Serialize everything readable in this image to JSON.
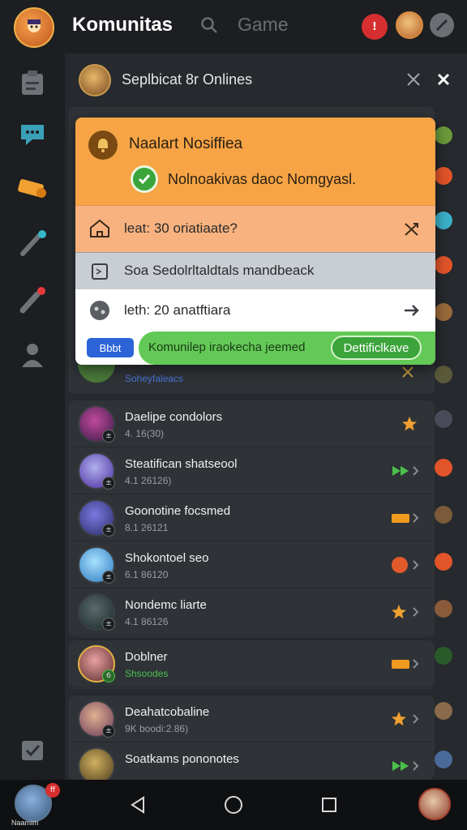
{
  "header": {
    "title": "Komunitas",
    "search_label": "Game",
    "notification_count": "!"
  },
  "panel": {
    "title": "Seplbicat 8r Onlines"
  },
  "popup": {
    "title": "Naalart Nosiffiea",
    "message": "Nolnoakivas daoc Nomgyasl.",
    "row1": "leat: 30 oriatiaate?",
    "row2": "Soa Sedolrltaldtals mandbeack",
    "row3": "leth: 20 anatftiara",
    "chip": "Bbbt",
    "banner": "Komunilep iraokecha jeemed",
    "cta": "Dettificlkave"
  },
  "partial_row": {
    "meta": "Soheyfaleacs"
  },
  "list1": [
    {
      "name": "Daelipe condolors",
      "meta": "4. 16(30)",
      "action": "star",
      "badge": "±"
    },
    {
      "name": "Steatifican shatseool",
      "meta": "4.1 26126)",
      "action": "arrow",
      "badge": "±"
    },
    {
      "name": "Goonotine focsmed",
      "meta": "8.1 26121",
      "action": "ticket",
      "badge": "±"
    },
    {
      "name": "Shokontoel seo",
      "meta": "6.1 86120",
      "action": "coin",
      "badge": "±"
    },
    {
      "name": "Nondemc liarte",
      "meta": "4.1 86126",
      "action": "star",
      "badge": "±"
    }
  ],
  "list2": [
    {
      "name": "Doblner",
      "meta": "Shsoodes",
      "action": "ticket",
      "badge": "6"
    }
  ],
  "list3": [
    {
      "name": "Deahatcobaline",
      "meta": "9K boodi:2.86)",
      "action": "star",
      "badge": "±"
    },
    {
      "name": "Soatkams pononotes",
      "meta": "",
      "action": "arrow",
      "badge": ""
    }
  ],
  "bottom_nav": {
    "avatar_label": "Naamim",
    "badge": "ff"
  },
  "colors": {
    "accent_orange": "#f6a445",
    "accent_green": "#3ba43b",
    "alert_red": "#d62f2f"
  }
}
